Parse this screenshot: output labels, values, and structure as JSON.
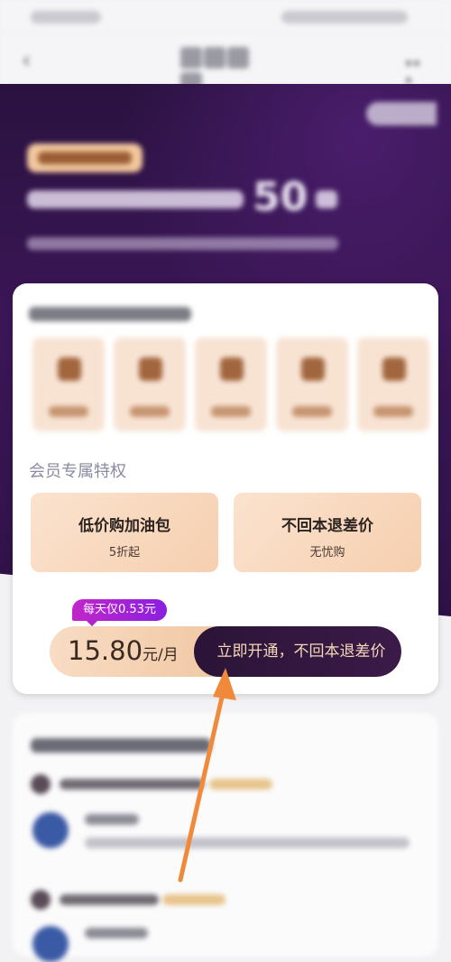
{
  "perks_section": {
    "title": "会员专属特权"
  },
  "perks": [
    {
      "name": "低价购加油包",
      "sub": "5折起"
    },
    {
      "name": "不回本退差价",
      "sub": "无忧购"
    }
  ],
  "purchase": {
    "ribbon": "每天仅0.53元",
    "price": "15.80",
    "price_unit": "元/月",
    "cta": "立即开通，不回本退差价"
  },
  "hero": {
    "big_number": "50"
  },
  "colors": {
    "hero_dark": "#2e1246",
    "perk_peach": "#f6cfaf",
    "ribbon_purple": "#a924d6",
    "cta_dark": "#2b1437",
    "cta_text": "#f4d8b8",
    "arrow": "#f08a3a"
  }
}
